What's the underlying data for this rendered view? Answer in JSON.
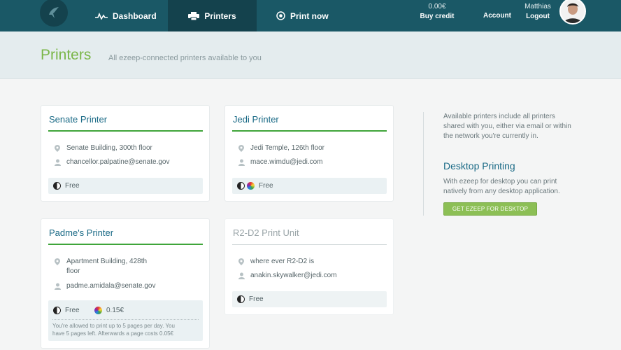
{
  "nav": {
    "dashboard": "Dashboard",
    "printers": "Printers",
    "print_now": "Print now"
  },
  "account": {
    "credit_amount": "0.00€",
    "buy_credit": "Buy credit",
    "account": "Account",
    "user_name": "Matthias",
    "logout": "Logout"
  },
  "page": {
    "title": "Printers",
    "subtitle": "All ezeep-connected printers available to you"
  },
  "printers": [
    {
      "name": "Senate Printer",
      "location": "Senate Building, 300th floor",
      "owner": "chancellor.palpatine@senate.gov",
      "price_bw": "Free"
    },
    {
      "name": "Jedi Printer",
      "location": "Jedi Temple, 126th floor",
      "owner": "mace.wimdu@jedi.com",
      "price_bw": "Free"
    },
    {
      "name": "Padme's Printer",
      "location_line1": "Apartment Building, 428th",
      "location_line2": "floor",
      "owner": "padme.amidala@senate.gov",
      "price_bw": "Free",
      "price_color": "0.15€",
      "note_line1": "You're allowed to print up to 5 pages per day. You",
      "note_line2": "have 5 pages left. Afterwards a page costs 0.05€"
    },
    {
      "name": "R2-D2 Print Unit",
      "location": "where ever R2-D2 is",
      "owner": "anakin.skywalker@jedi.com",
      "price_bw": "Free"
    }
  ],
  "sidebar": {
    "intro_line1": "Available printers include all printers",
    "intro_line2": "shared with you, either via email or within",
    "intro_line3": "the network you're currently in.",
    "desktop_heading": "Desktop Printing",
    "desktop_line1": "With ezeep for desktop you can print",
    "desktop_line2": "natively from any desktop application.",
    "desktop_button": "GET EZEEP FOR DESKTOP"
  },
  "colors": {
    "topbar": "#1a5866",
    "active_tab": "#14424d",
    "title_green": "#7ab648",
    "link_blue": "#1a6a86",
    "rule_green": "#3fa53a",
    "button_green": "#8cbf55"
  }
}
